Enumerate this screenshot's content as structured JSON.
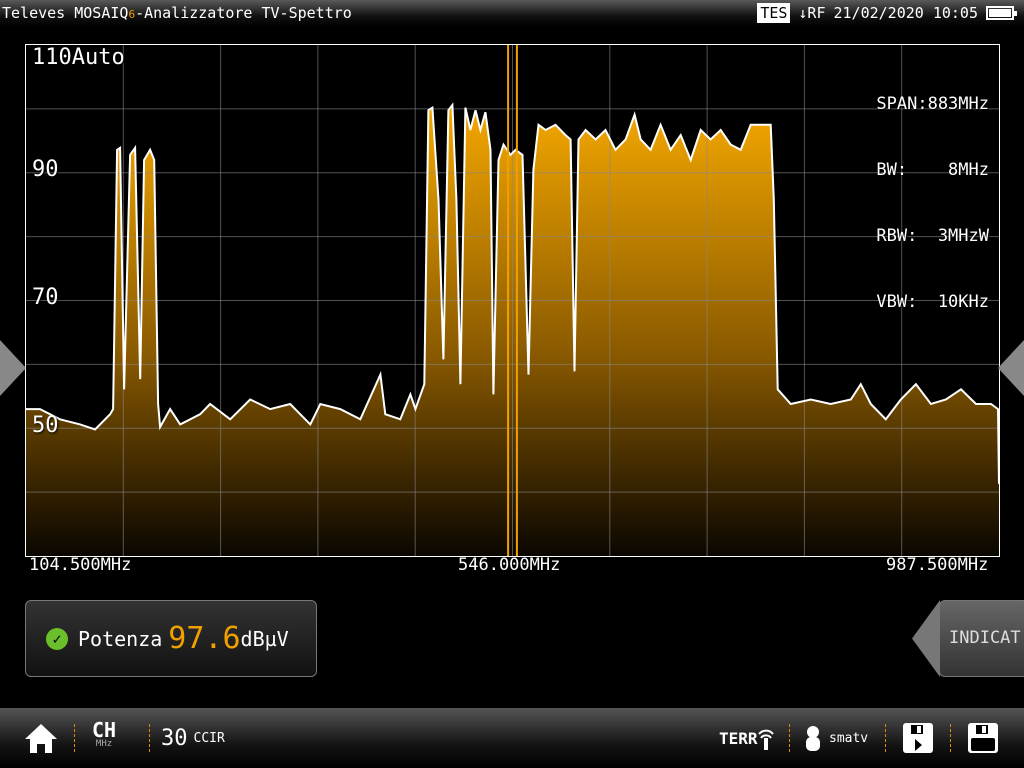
{
  "header": {
    "brand": "Televes MOSAIQ",
    "brand_suffix": "6",
    "title": "-Analizzatore TV-Spettro",
    "tes": "TES",
    "input": "↓RF",
    "datetime": "21/02/2020 10:05"
  },
  "overlay": {
    "scale": "110Auto",
    "span": "SPAN:883MHz",
    "bw": "BW:    8MHz",
    "rbw": "RBW:  3MHzW",
    "vbw": "VBW:  10KHz"
  },
  "colors": {
    "accent": "#f0a000",
    "trace": "#ffffff"
  },
  "chart_data": {
    "type": "area",
    "title": "Spettro",
    "xlim": [
      104.5,
      987.5
    ],
    "ylim": [
      30,
      110
    ],
    "x_ticks": [
      "104.500MHz",
      "546.000MHz",
      "987.500MHz"
    ],
    "y_ticks": [
      "90",
      "70",
      "50"
    ],
    "y_tick_values": [
      90,
      70,
      50
    ],
    "grid": true,
    "marker": {
      "center": 546.0,
      "bandwidth": 8
    },
    "trace": [
      [
        104.5,
        53
      ],
      [
        117.2,
        53
      ],
      [
        135.4,
        51.4
      ],
      [
        153.6,
        50.6
      ],
      [
        167.2,
        49.8
      ],
      [
        180.8,
        52.2
      ],
      [
        183.5,
        53
      ],
      [
        187.2,
        93.6
      ],
      [
        189.9,
        93.9
      ],
      [
        193.5,
        56.1
      ],
      [
        199,
        92.8
      ],
      [
        203.5,
        93.9
      ],
      [
        208.1,
        57.7
      ],
      [
        211.7,
        92
      ],
      [
        217.1,
        93.6
      ],
      [
        220.8,
        92
      ],
      [
        224.4,
        53.8
      ],
      [
        226.2,
        50.2
      ],
      [
        235.3,
        53
      ],
      [
        244.4,
        50.6
      ],
      [
        262.6,
        52.2
      ],
      [
        271.6,
        53.8
      ],
      [
        289.8,
        51.4
      ],
      [
        308,
        54.5
      ],
      [
        326.1,
        53
      ],
      [
        344.3,
        53.8
      ],
      [
        362.5,
        50.6
      ],
      [
        371.6,
        53.8
      ],
      [
        389.7,
        53
      ],
      [
        407.9,
        51.4
      ],
      [
        426.1,
        58.4
      ],
      [
        430.6,
        52.2
      ],
      [
        444.2,
        51.4
      ],
      [
        453.3,
        55.3
      ],
      [
        457.9,
        53
      ],
      [
        466,
        56.9
      ],
      [
        469.7,
        99.8
      ],
      [
        473.3,
        100.2
      ],
      [
        478.8,
        85.8
      ],
      [
        483.3,
        60.8
      ],
      [
        487.8,
        99.8
      ],
      [
        491.5,
        100.6
      ],
      [
        495.1,
        85.8
      ],
      [
        498.7,
        56.9
      ],
      [
        503.3,
        100.2
      ],
      [
        507.8,
        96.7
      ],
      [
        512.4,
        99.8
      ],
      [
        516.9,
        96.7
      ],
      [
        521.4,
        99.5
      ],
      [
        526,
        93.6
      ],
      [
        528.7,
        55.3
      ],
      [
        533.3,
        92
      ],
      [
        537.8,
        94.4
      ],
      [
        544.2,
        92.8
      ],
      [
        548.7,
        93.6
      ],
      [
        555.1,
        92.8
      ],
      [
        560.5,
        58.4
      ],
      [
        565,
        90.5
      ],
      [
        569.6,
        97.5
      ],
      [
        576,
        96.7
      ],
      [
        585,
        97.5
      ],
      [
        594.1,
        95.9
      ],
      [
        598.7,
        95.2
      ],
      [
        602.3,
        58.9
      ],
      [
        605.9,
        95.2
      ],
      [
        612.3,
        96.7
      ],
      [
        621.4,
        95.2
      ],
      [
        630.4,
        96.7
      ],
      [
        639.5,
        93.6
      ],
      [
        648.6,
        95.2
      ],
      [
        656.8,
        99.1
      ],
      [
        662.3,
        95.2
      ],
      [
        671.3,
        93.6
      ],
      [
        680.4,
        97.5
      ],
      [
        689.5,
        93.6
      ],
      [
        698.6,
        95.9
      ],
      [
        707.7,
        92
      ],
      [
        716.8,
        96.7
      ],
      [
        725.8,
        95.2
      ],
      [
        734.9,
        96.7
      ],
      [
        744,
        94.4
      ],
      [
        753.1,
        93.6
      ],
      [
        762.2,
        97.5
      ],
      [
        771.3,
        97.5
      ],
      [
        780.3,
        97.5
      ],
      [
        783.1,
        85.8
      ],
      [
        786.7,
        56.1
      ],
      [
        798.5,
        53.8
      ],
      [
        816.7,
        54.5
      ],
      [
        834.8,
        53.8
      ],
      [
        853,
        54.5
      ],
      [
        862.1,
        56.9
      ],
      [
        871.2,
        53.8
      ],
      [
        884.8,
        51.4
      ],
      [
        898.4,
        54.5
      ],
      [
        912.1,
        56.9
      ],
      [
        925.7,
        53.8
      ],
      [
        939.3,
        54.5
      ],
      [
        953,
        56.1
      ],
      [
        966.6,
        53.8
      ],
      [
        980.2,
        53.8
      ],
      [
        986.6,
        53
      ],
      [
        987.5,
        41.3
      ]
    ]
  },
  "power": {
    "label": "Potenza",
    "value": "97.6",
    "unit": "dBµV"
  },
  "right_button": {
    "label": "INDICAT"
  },
  "bottom": {
    "ch": "CH",
    "mhz": "MHz",
    "channel": "30",
    "plan": "CCIR",
    "band": "TERR",
    "user": "smatv"
  }
}
